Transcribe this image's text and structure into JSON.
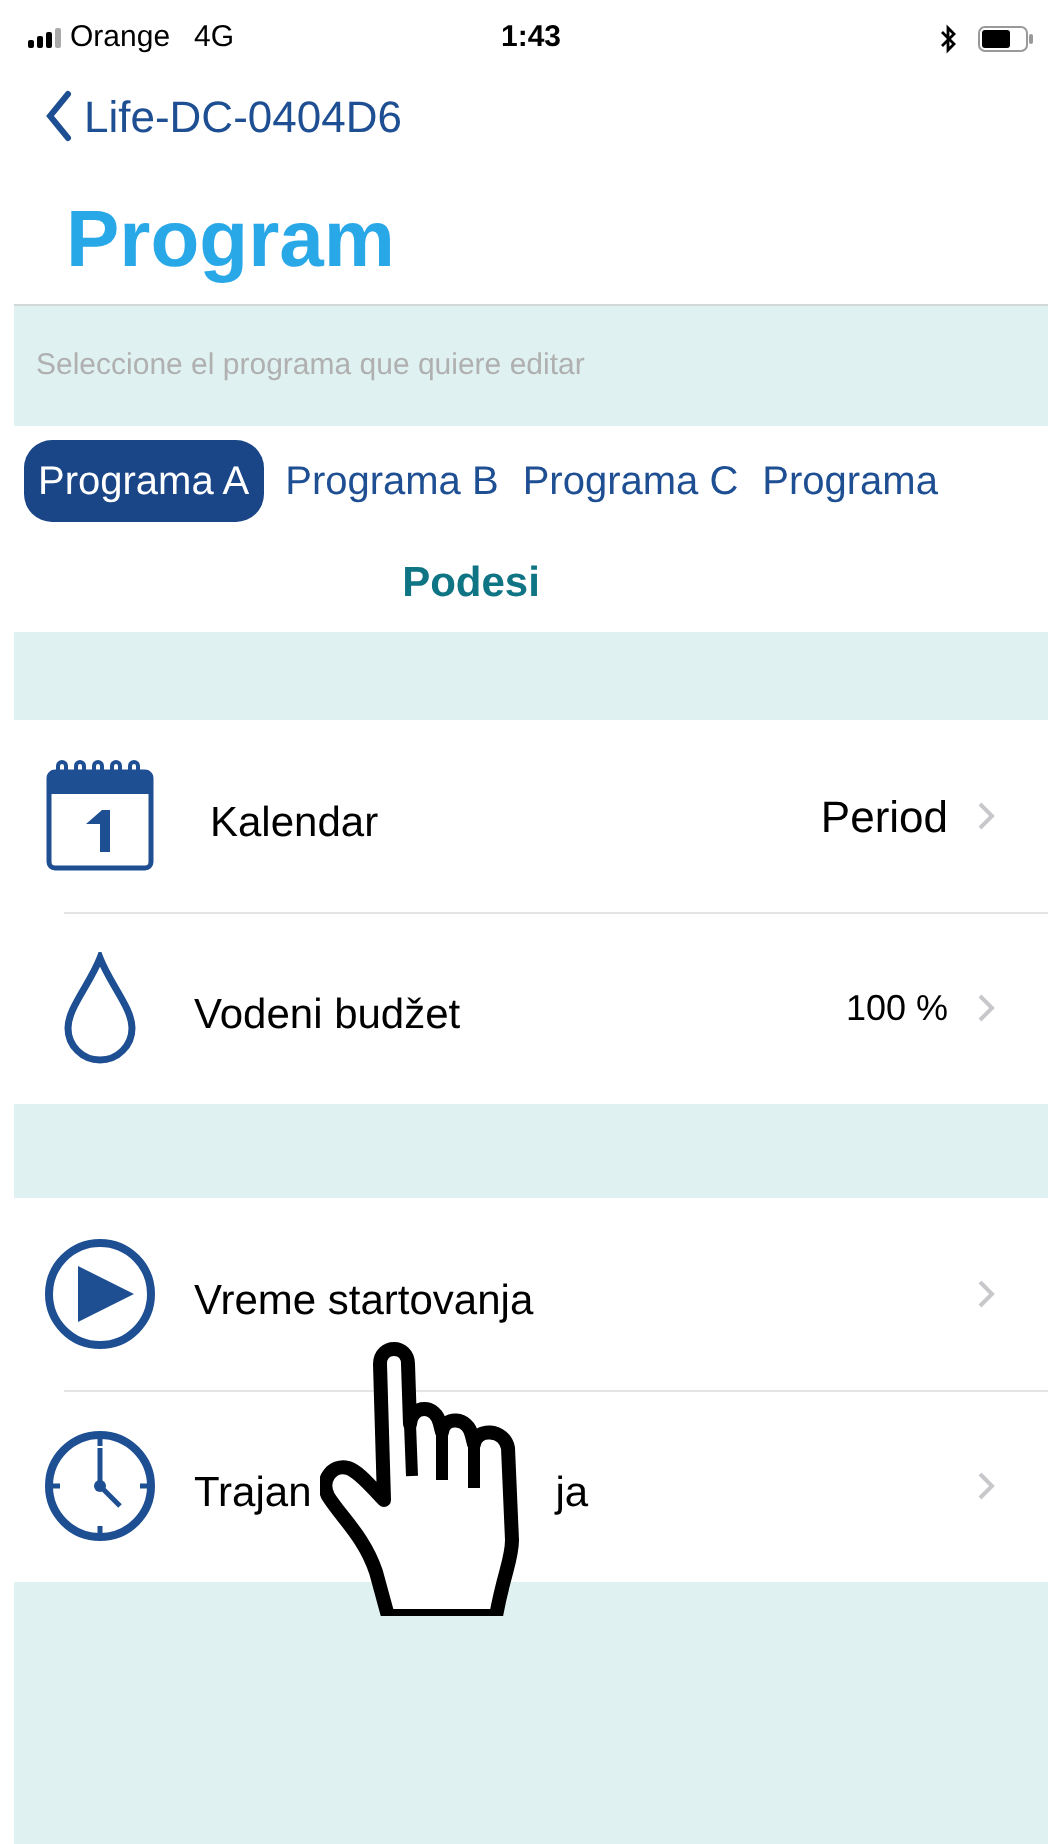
{
  "status_bar": {
    "carrier": "Orange",
    "network": "4G",
    "time": "1:43"
  },
  "nav": {
    "back_label": "Life-DC-0404D6"
  },
  "title": "Program",
  "hint": "Seleccione el programa que quiere editar",
  "tabs": [
    {
      "label": "Programa A",
      "selected": true
    },
    {
      "label": "Programa B",
      "selected": false
    },
    {
      "label": "Programa C",
      "selected": false
    },
    {
      "label": "Programa",
      "selected": false
    }
  ],
  "section_title": "Podesi",
  "groups": [
    {
      "rows": [
        {
          "kind": "calendar",
          "label": "Kalendar",
          "value": "Period"
        },
        {
          "kind": "drop",
          "label": "Vodeni budžet",
          "value": "100 %"
        }
      ]
    },
    {
      "rows": [
        {
          "kind": "play",
          "label": "Vreme startovanja"
        },
        {
          "kind": "clock",
          "label": "Trajan",
          "label_tail": "ja"
        }
      ]
    }
  ]
}
